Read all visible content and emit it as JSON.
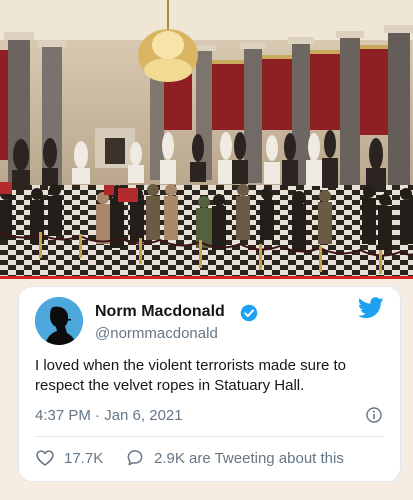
{
  "photo": {
    "icon": "statuary-hall-photo"
  },
  "tweet": {
    "author": {
      "name": "Norm Macdonald",
      "handle": "@normmacdonald",
      "verified": true,
      "avatar_icon": "profile-silhouette-icon"
    },
    "text": "I loved when the violent terrorists made sure to respect the velvet ropes in Statuary Hall.",
    "timestamp": "4:37 PM · Jan 6, 2021",
    "likes": "17.7K",
    "replies_text": "2.9K are Tweeting about this",
    "colors": {
      "brand": "#1da1f2",
      "divider": "#d0281e",
      "text": "#14171a",
      "muted": "#657786"
    }
  }
}
